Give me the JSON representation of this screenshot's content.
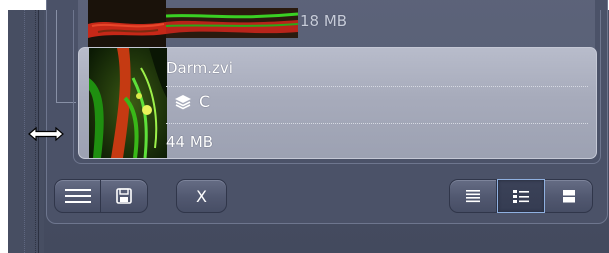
{
  "files": [
    {
      "name": "",
      "size": "18 MB",
      "channel": ""
    },
    {
      "name": "Darm.zvi",
      "size": "44 MB",
      "channel": "C"
    }
  ],
  "toolbar": {
    "close_label": "X"
  },
  "view_modes": [
    "list-view-icon",
    "detail-view-icon",
    "large-view-icon"
  ],
  "selected_view_mode": "detail-view-icon",
  "colors": {
    "background": "#434a5e",
    "selected_item": "#a7abbb",
    "active_border": "#8fb0e0"
  }
}
